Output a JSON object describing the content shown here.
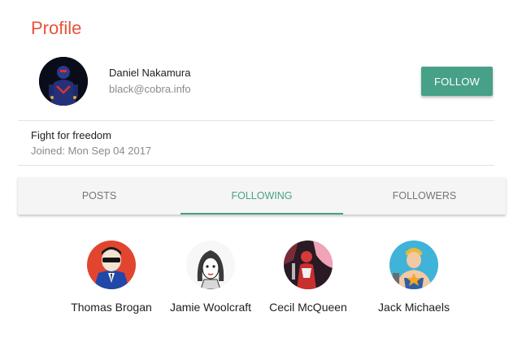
{
  "header": {
    "title": "Profile"
  },
  "user": {
    "name": "Daniel Nakamura",
    "email": "black@cobra.info",
    "bio": "Fight for freedom",
    "joined": "Joined: Mon Sep 04 2017"
  },
  "actions": {
    "follow_label": "FOLLOW"
  },
  "tabs": [
    {
      "label": "POSTS",
      "active": false
    },
    {
      "label": "FOLLOWING",
      "active": true
    },
    {
      "label": "FOLLOWERS",
      "active": false
    }
  ],
  "following": [
    {
      "name": "Thomas Brogan",
      "avatar": "comic-man-sunglasses"
    },
    {
      "name": "Jamie Woolcraft",
      "avatar": "comic-woman-sketch"
    },
    {
      "name": "Cecil McQueen",
      "avatar": "comic-red-figure"
    },
    {
      "name": "Jack Michaels",
      "avatar": "comic-hero-star"
    }
  ],
  "colors": {
    "accent": "#47a088",
    "title": "#e8533a"
  }
}
